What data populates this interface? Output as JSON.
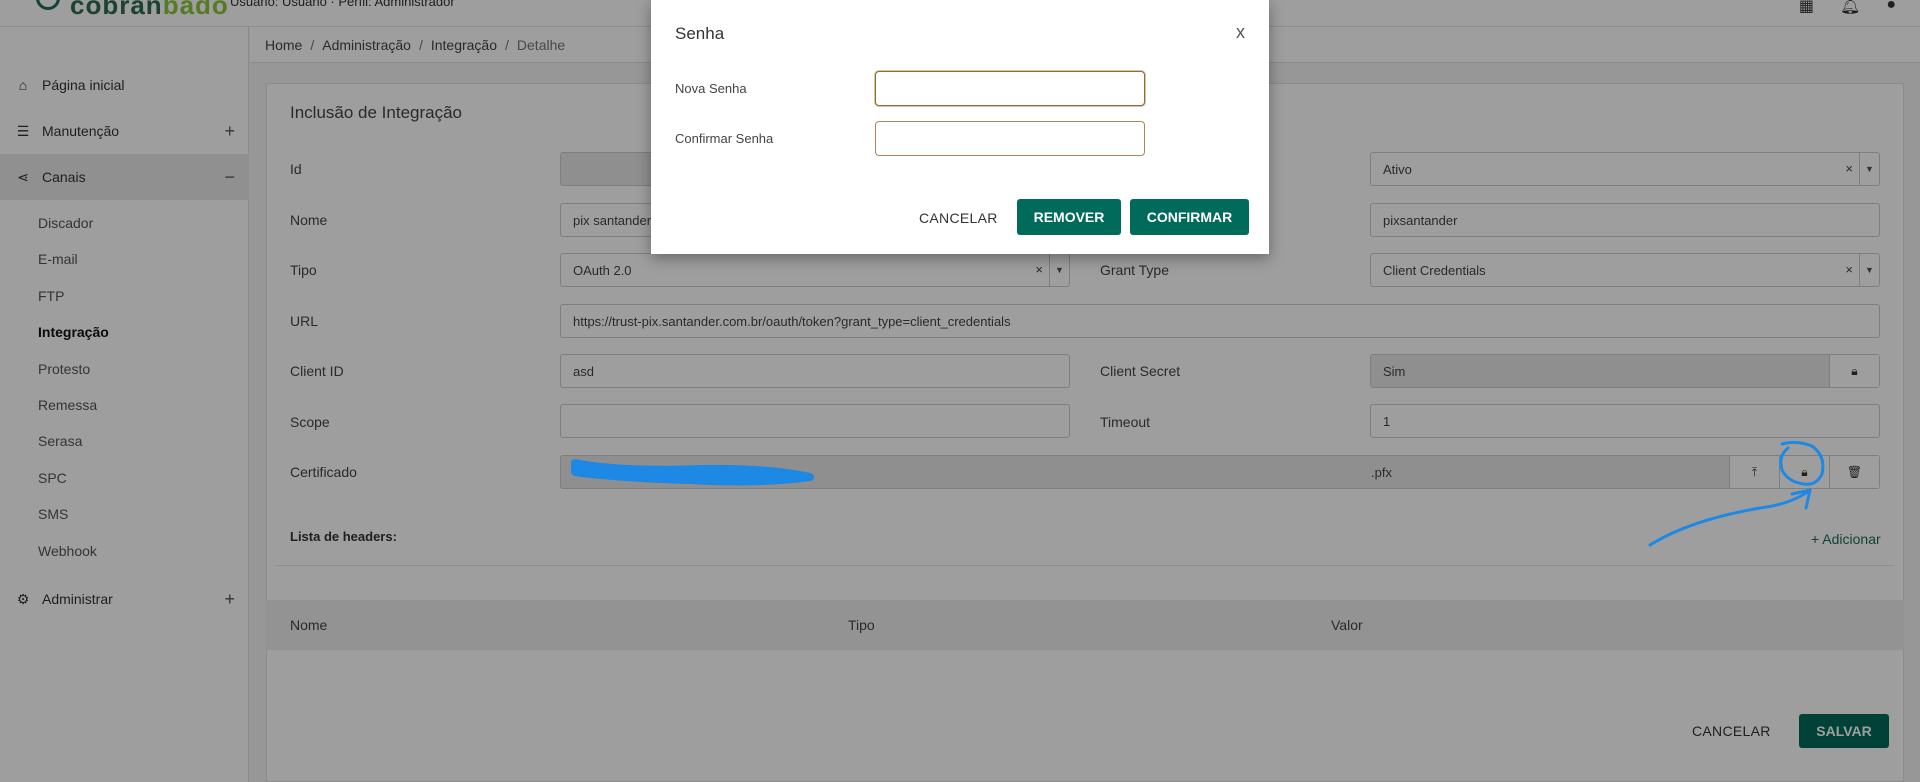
{
  "topbar": {
    "logo_text_a": "cobran",
    "logo_text_b": "bado",
    "user_info": "Usuário: Usuário  ·  Perfil: Administrador"
  },
  "sidebar": {
    "items": [
      {
        "label": "Página inicial",
        "icon": "home-icon"
      },
      {
        "label": "Manutenção",
        "icon": "database-icon",
        "expander": "+"
      },
      {
        "label": "Canais",
        "icon": "share-icon",
        "expander": "−"
      },
      {
        "label": "Administrar",
        "icon": "gear-icon",
        "expander": "+"
      }
    ],
    "subitems": [
      "Discador",
      "E-mail",
      "FTP",
      "Integração",
      "Protesto",
      "Remessa",
      "Serasa",
      "SPC",
      "SMS",
      "Webhook"
    ]
  },
  "breadcrumb": [
    "Home",
    "Administração",
    "Integração",
    "Detalhe"
  ],
  "form": {
    "title": "Inclusão de Integração",
    "labels": {
      "id": "Id",
      "nome": "Nome",
      "tipo": "Tipo",
      "grant_type": "Grant Type",
      "url": "URL",
      "client_id": "Client ID",
      "client_secret": "Client Secret",
      "scope": "Scope",
      "timeout": "Timeout",
      "certificado": "Certificado"
    },
    "values": {
      "status": "Ativo",
      "nome": "pix santander",
      "username": "pixsantander",
      "tipo": "OAuth 2.0",
      "grant_type": "Client Credentials",
      "url": "https://trust-pix.santander.com.br/oauth/token?grant_type=client_credentials",
      "client_id": "asd",
      "client_secret": "Sim",
      "scope": "",
      "timeout": "1",
      "certificado": ".pfx"
    },
    "clear_glyph": "×",
    "caret_glyph": "▼"
  },
  "headers": {
    "title": "Lista de headers:",
    "add_label": "+ Adicionar",
    "columns": [
      "Nome",
      "Tipo",
      "Valor"
    ]
  },
  "footer": {
    "cancel_label": "CANCELAR",
    "save_label": "SALVAR"
  },
  "modal": {
    "title": "Senha",
    "close_label": "x",
    "new_password_label": "Nova Senha",
    "confirm_password_label": "Confirmar Senha",
    "new_password_value": "",
    "confirm_password_value": "",
    "cancel_label": "CANCELAR",
    "remove_label": "REMOVER",
    "confirm_label": "CONFIRMAR"
  },
  "colors": {
    "primary": "#006b5a",
    "annotation": "#1e90ff"
  }
}
